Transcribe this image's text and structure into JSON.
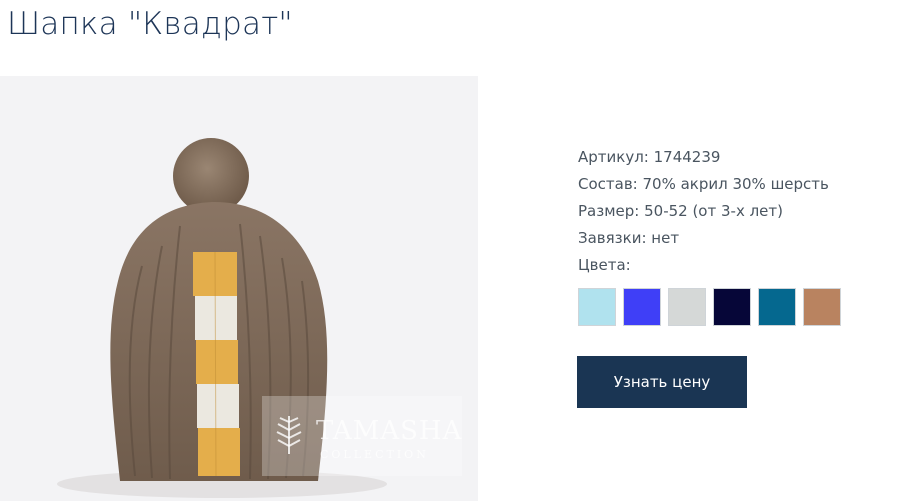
{
  "product": {
    "title": "Шапка \"Квадрат\""
  },
  "image": {
    "watermark_text": "TAMASHA",
    "watermark_sub": "COLLECTION"
  },
  "details": {
    "article": "Артикул: 1744239",
    "composition": "Состав: 70% акрил 30% шерсть",
    "size": "Размер: 50-52 (от 3-х лет)",
    "ties": "Завязки: нет",
    "colors_label": "Цвета:"
  },
  "colors": [
    "#b0e2ee",
    "#3f3ff7",
    "#d5d8d7",
    "#060638",
    "#05688f",
    "#b98360"
  ],
  "actions": {
    "price_button": "Узнать цену"
  }
}
